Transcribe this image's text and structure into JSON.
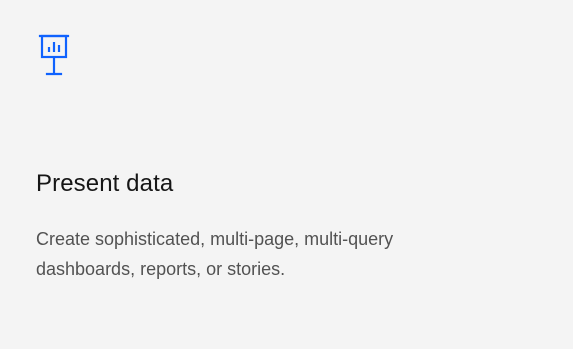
{
  "card": {
    "icon": "presentation-chart-icon",
    "title": "Present data",
    "description": "Create sophisticated, multi-page, multi-query dashboards, reports, or stories."
  },
  "colors": {
    "card_background": "#f4f4f4",
    "icon_accent": "#0f62fe",
    "title_text": "#161616",
    "description_text": "#525252"
  }
}
